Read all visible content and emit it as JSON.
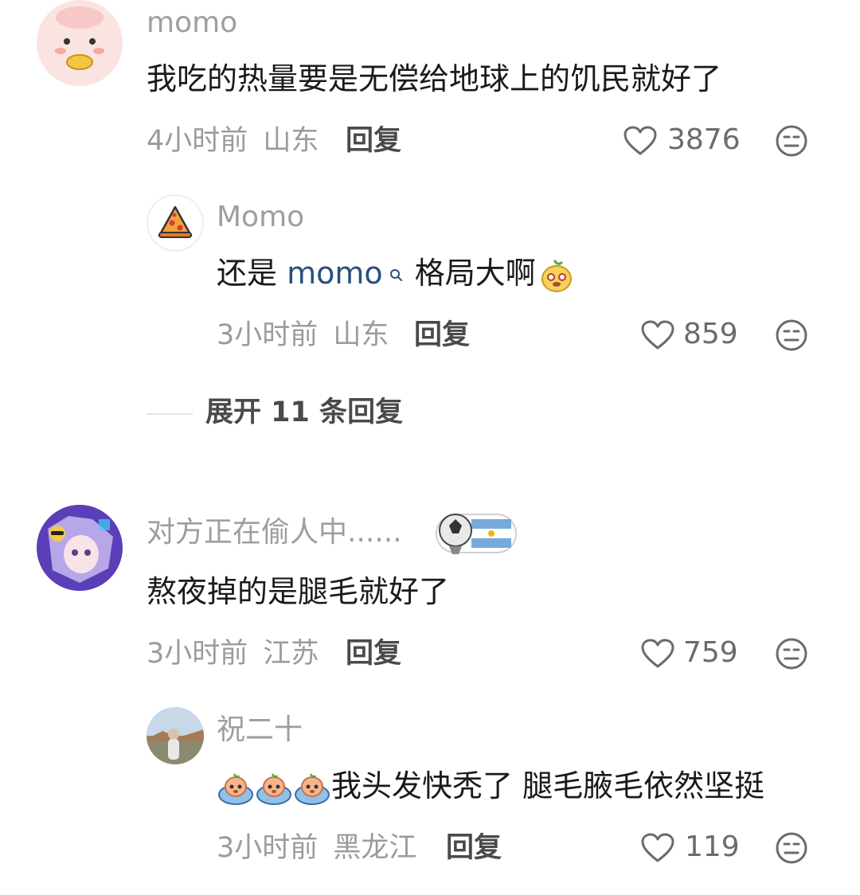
{
  "comments": [
    {
      "username": "momo",
      "text": "我吃的热量要是无偿给地球上的饥民就好了",
      "time": "4小时前",
      "location": "山东",
      "reply_label": "回复",
      "likes": "3876"
    },
    {
      "username": "Momo",
      "text_prefix": "还是 ",
      "mention": "momo",
      "text_suffix": " 格局大啊",
      "time": "3小时前",
      "location": "山东",
      "reply_label": "回复",
      "likes": "859"
    },
    {
      "username": "对方正在偷人中......",
      "text": "熬夜掉的是腿毛就好了",
      "time": "3小时前",
      "location": "江苏",
      "reply_label": "回复",
      "likes": "759"
    },
    {
      "username": "祝二十",
      "text": "我头发快秃了 腿毛腋毛依然坚挺",
      "time": "3小时前",
      "location": "黑龙江",
      "reply_label": "回复",
      "likes": "119"
    }
  ],
  "expand_replies": "展开 11 条回复",
  "icons": {
    "like": "heart-outline-icon",
    "dislike": "meh-face-icon",
    "mention": "search-icon"
  },
  "colors": {
    "username": "#9e9e9e",
    "mention": "#2b4f7e",
    "meta": "#9b9b9b"
  }
}
